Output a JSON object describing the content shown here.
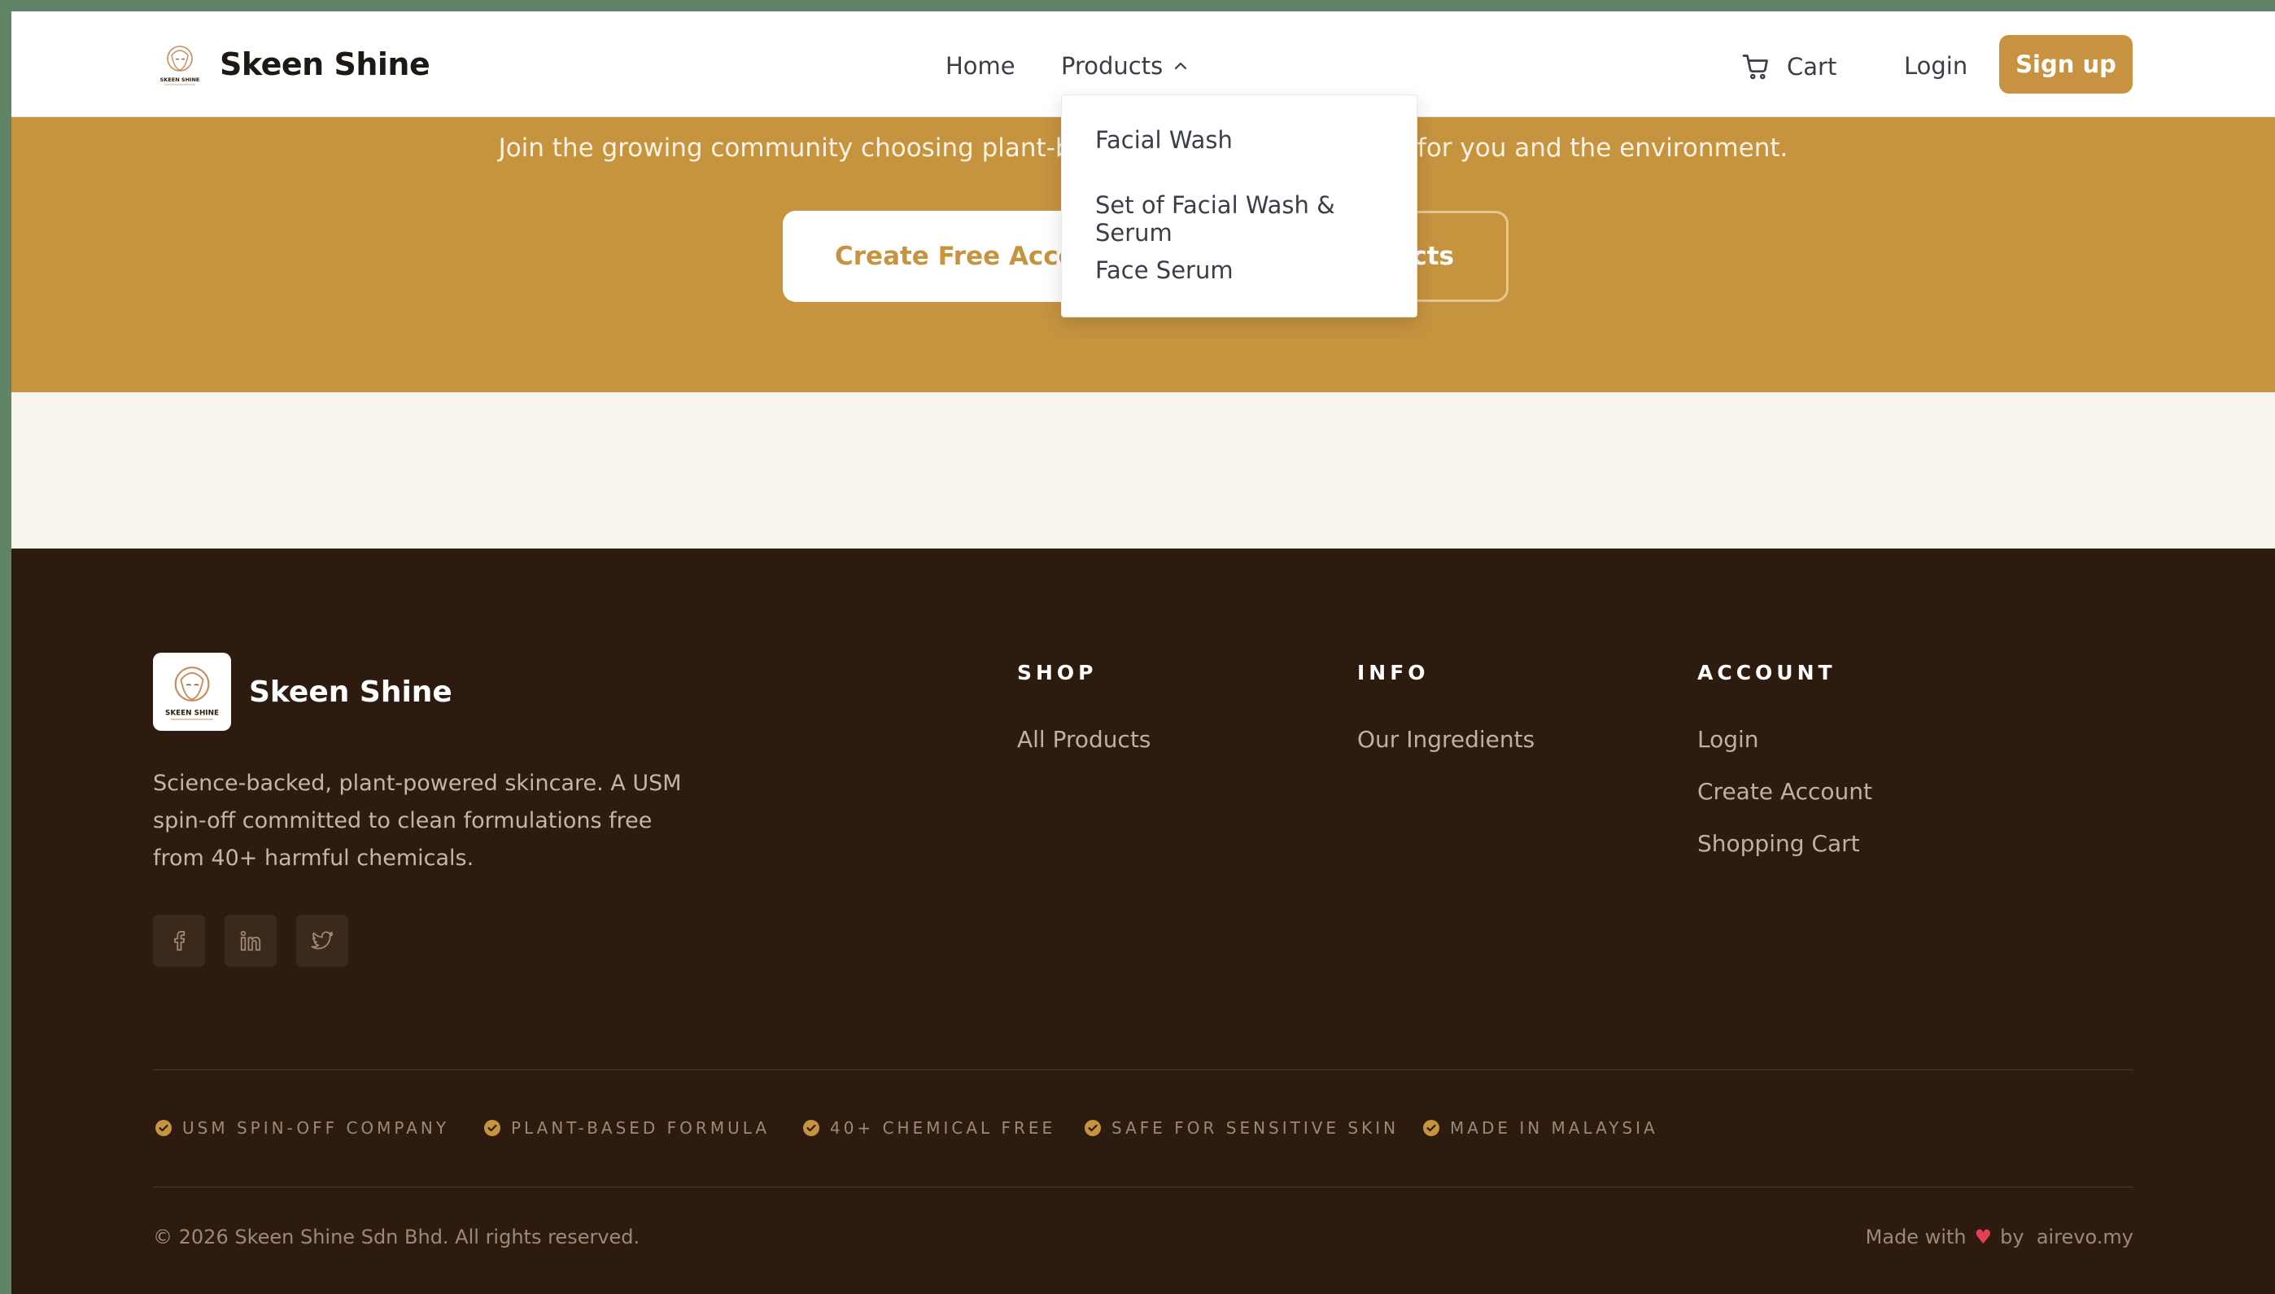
{
  "brand": {
    "name": "Skeen Shine",
    "logo_text": "SKEEN SHINE"
  },
  "nav": {
    "home": "Home",
    "products": "Products",
    "cart": "Cart",
    "login": "Login",
    "signup": "Sign up"
  },
  "dropdown": {
    "items": [
      "Facial Wash",
      "Set of Facial Wash & Serum",
      "Face Serum"
    ]
  },
  "cta": {
    "subtitle": "Join the growing community choosing plant-based skincare that's better for you and the environment.",
    "primary": "Create Free Account",
    "secondary": "Browse Products"
  },
  "footer": {
    "brand": "Skeen Shine",
    "description": "Science-backed, plant-powered skincare. A USM spin-off committed to clean formulations free from 40+ harmful chemicals.",
    "social": [
      "facebook-icon",
      "linkedin-icon",
      "twitter-icon"
    ],
    "columns": [
      {
        "heading": "SHOP",
        "links": [
          "All Products"
        ]
      },
      {
        "heading": "INFO",
        "links": [
          "Our Ingredients"
        ]
      },
      {
        "heading": "ACCOUNT",
        "links": [
          "Login",
          "Create Account",
          "Shopping Cart"
        ]
      }
    ],
    "badges": [
      "USM SPIN-OFF COMPANY",
      "PLANT-BASED FORMULA",
      "40+ CHEMICAL FREE",
      "SAFE FOR SENSITIVE SKIN",
      "MADE IN MALAYSIA"
    ],
    "copyright": "© 2026 Skeen Shine Sdn Bhd. All rights reserved.",
    "made_with": "Made with",
    "by": "by",
    "credit": "airevo.my"
  },
  "colors": {
    "accent": "#c6943f",
    "footer_bg": "#2c1b0e",
    "heart": "#e0434f"
  }
}
